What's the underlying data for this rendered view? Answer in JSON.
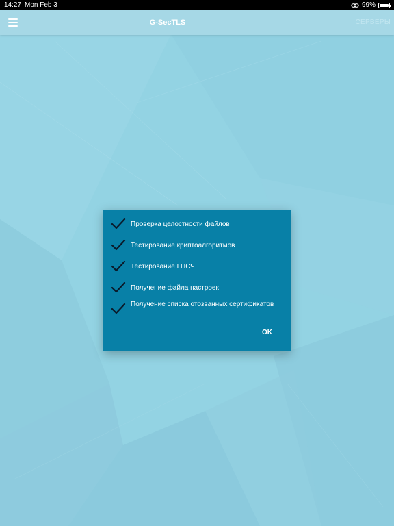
{
  "status_bar": {
    "time": "14:27",
    "date": "Mon Feb 3",
    "battery_text": "99%",
    "battery_level": 0.99
  },
  "app_bar": {
    "title": "G-SecTLS",
    "servers_label": "СЕРВЕРЫ"
  },
  "dialog": {
    "items": [
      {
        "label": "Проверка целостности файлов",
        "checked": true
      },
      {
        "label": "Тестирование криптоалгоритмов",
        "checked": true
      },
      {
        "label": "Тестирование ГПСЧ",
        "checked": true
      },
      {
        "label": "Получение файла настроек",
        "checked": true
      },
      {
        "label": "Получение списка отозванных сертификатов",
        "checked": true
      }
    ],
    "ok_label": "OK"
  },
  "colors": {
    "background": "#93d3e3",
    "dialog": "#0880a7",
    "check": "#0a1a2a"
  },
  "icons": [
    "menu-icon",
    "link-icon",
    "battery-icon",
    "checkmark-icon"
  ]
}
